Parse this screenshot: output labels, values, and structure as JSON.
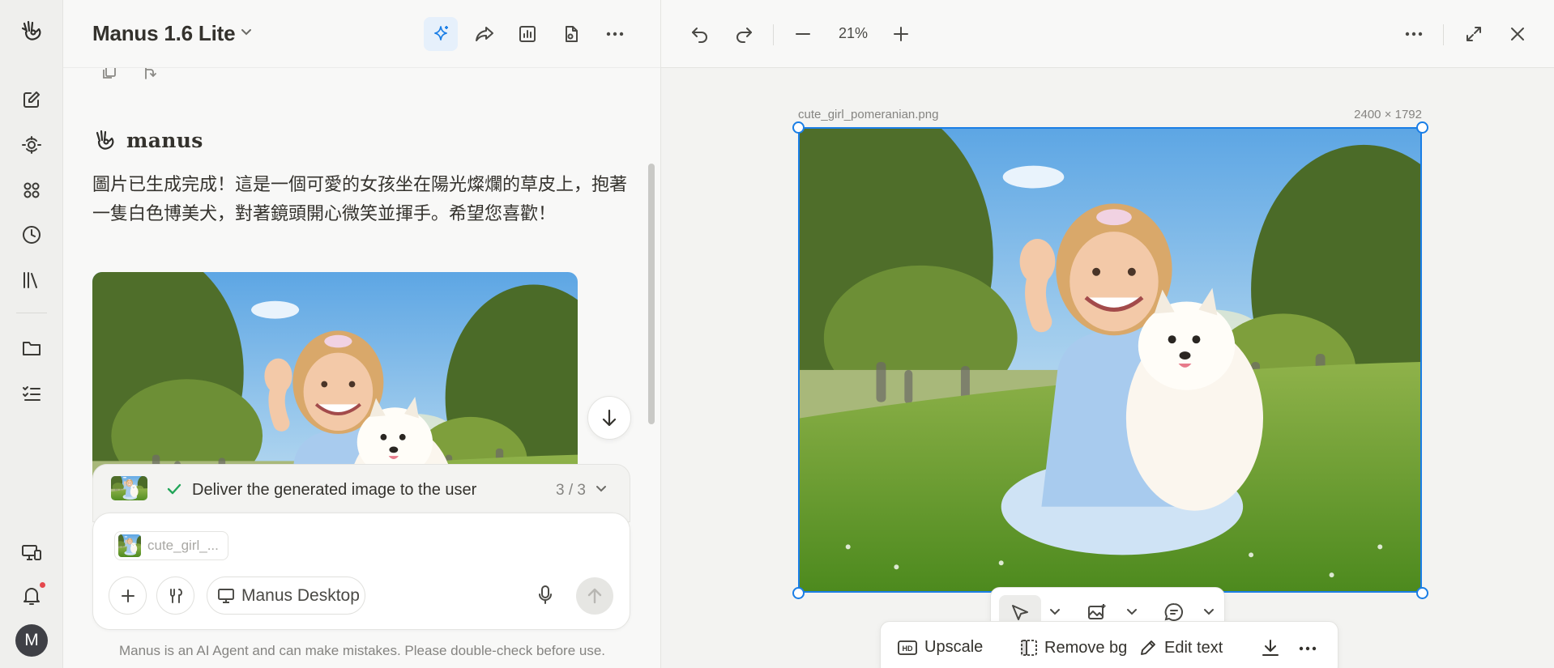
{
  "sidebar": {
    "items": [
      {
        "icon": "manus-logo-icon"
      },
      {
        "icon": "new-task-icon"
      },
      {
        "icon": "agents-icon"
      },
      {
        "icon": "apps-grid-icon"
      },
      {
        "icon": "history-clock-icon"
      },
      {
        "icon": "library-icon"
      },
      {
        "icon": "folder-icon"
      },
      {
        "icon": "tasks-list-icon"
      },
      {
        "icon": "devices-icon"
      },
      {
        "icon": "bell-icon"
      }
    ],
    "avatar_initial": "M",
    "notification_color": "#e5484d"
  },
  "chat": {
    "model_title": "Manus 1.6 Lite",
    "sender_name": "manus",
    "message": "圖片已生成完成！這是一個可愛的女孩坐在陽光燦爛的草皮上，抱著一隻白色博美犬，對著鏡頭開心微笑並揮手。希望您喜歡！",
    "task": {
      "label": "Deliver the generated image to the user",
      "count": "3 / 3"
    },
    "composer": {
      "attachment_name": "cute_girl_...",
      "connector_label": "Manus Desktop"
    },
    "disclaimer": "Manus is an AI Agent and can make mistakes. Please double-check before use."
  },
  "preview": {
    "zoom": "21%",
    "file_name": "cute_girl_pomeranian.png",
    "file_dims": "2400 × 1792",
    "actions": {
      "upscale": "Upscale",
      "remove_bg": "Remove bg",
      "edit_text": "Edit text"
    }
  },
  "colors": {
    "accent": "#1a7ee6",
    "success": "#22a559"
  }
}
